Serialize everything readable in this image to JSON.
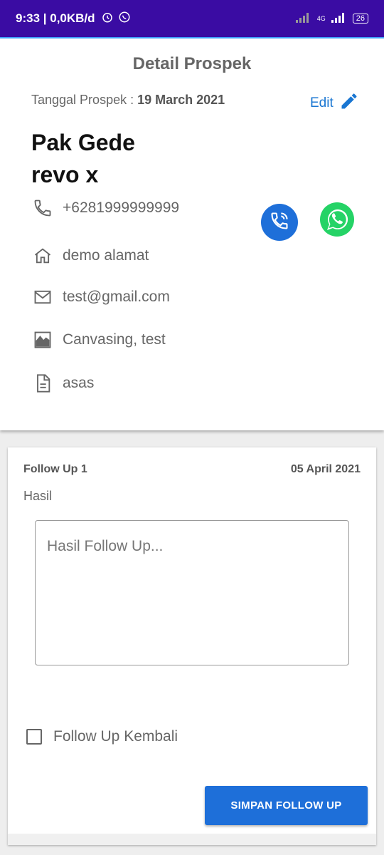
{
  "status_bar": {
    "time": "9:33",
    "network_speed": "0,0KB/d",
    "battery": "26",
    "network_type": "4G"
  },
  "header": {
    "title": "Detail Prospek"
  },
  "prospect": {
    "date_label": "Tanggal Prospek : ",
    "date_value": "19 March 2021",
    "edit_label": "Edit",
    "name_line1": "Pak Gede",
    "name_line2": "revo x",
    "phone": "+6281999999999",
    "address": "demo alamat",
    "email": "test@gmail.com",
    "source": "Canvasing, test",
    "note": "asas"
  },
  "follow_up": {
    "title": "Follow Up 1",
    "date": "05 April 2021",
    "result_label": "Hasil",
    "result_placeholder": "Hasil Follow Up...",
    "again_label": "Follow Up Kembali",
    "save_label": "SIMPAN FOLLOW UP"
  },
  "colors": {
    "status_bar": "#3a0ca3",
    "accent_blue": "#1e6fd9",
    "whatsapp_green": "#25d366"
  }
}
